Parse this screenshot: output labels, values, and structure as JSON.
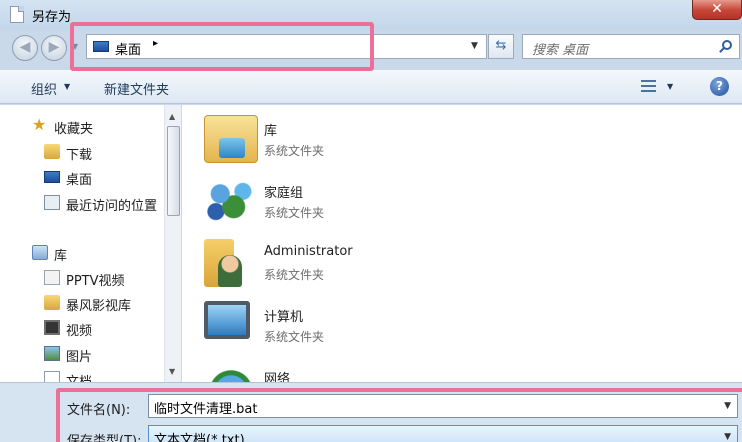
{
  "window": {
    "title": "另存为",
    "close_label": "✕"
  },
  "address": {
    "location": "桌面",
    "separator": "▸"
  },
  "search": {
    "placeholder": "搜索 桌面"
  },
  "toolbar": {
    "organize_label": "组织",
    "new_folder_label": "新建文件夹"
  },
  "sidebar": {
    "items": [
      {
        "label": "收藏夹",
        "icon": "star-icon"
      },
      {
        "label": "下载",
        "icon": "download-folder-icon"
      },
      {
        "label": "桌面",
        "icon": "desktop-icon"
      },
      {
        "label": "最近访问的位置",
        "icon": "recent-places-icon"
      },
      {
        "label": "库",
        "icon": "library-icon"
      },
      {
        "label": "PPTV视频",
        "icon": "pptv-icon"
      },
      {
        "label": "暴风影视库",
        "icon": "folder-icon"
      },
      {
        "label": "视频",
        "icon": "video-icon"
      },
      {
        "label": "图片",
        "icon": "pictures-icon"
      },
      {
        "label": "文档",
        "icon": "document-icon"
      }
    ]
  },
  "files": [
    {
      "name": "库",
      "type": "系统文件夹",
      "icon": "library-folder-icon"
    },
    {
      "name": "家庭组",
      "type": "系统文件夹",
      "icon": "homegroup-icon"
    },
    {
      "name": "Administrator",
      "type": "系统文件夹",
      "icon": "user-folder-icon"
    },
    {
      "name": "计算机",
      "type": "系统文件夹",
      "icon": "computer-icon"
    },
    {
      "name": "网络",
      "type": "",
      "icon": "network-icon"
    }
  ],
  "save": {
    "filename_label": "文件名(N):",
    "filename_value": "临时文件清理.bat",
    "filetype_label": "保存类型(T):",
    "filetype_value": "文本文档(*.txt)"
  },
  "colors": {
    "highlight": "#ec6f9a",
    "window_frame": "#c9d9ea"
  }
}
